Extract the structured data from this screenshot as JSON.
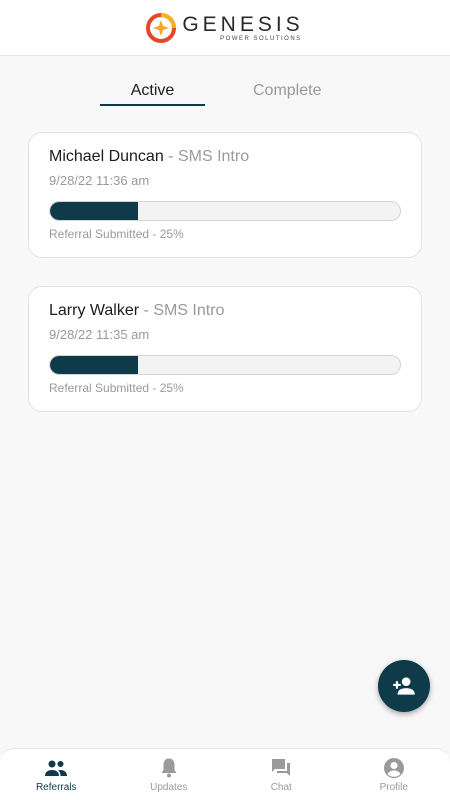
{
  "brand": {
    "name": "GENESIS",
    "subtitle": "POWER SOLUTIONS"
  },
  "tabs": {
    "active_label": "Active",
    "complete_label": "Complete"
  },
  "referrals": [
    {
      "name": "Michael Duncan",
      "separator": " - ",
      "type": "SMS Intro",
      "date": "9/28/22 11:36 am",
      "progress_percent": 25,
      "status": "Referral Submitted - 25%"
    },
    {
      "name": "Larry Walker",
      "separator": " - ",
      "type": "SMS Intro",
      "date": "9/28/22 11:35 am",
      "progress_percent": 25,
      "status": "Referral Submitted - 25%"
    }
  ],
  "nav": {
    "referrals": "Referrals",
    "updates": "Updates",
    "chat": "Chat",
    "profile": "Profile"
  },
  "colors": {
    "accent": "#0f3a4a",
    "inactive": "#9a9a9a"
  }
}
